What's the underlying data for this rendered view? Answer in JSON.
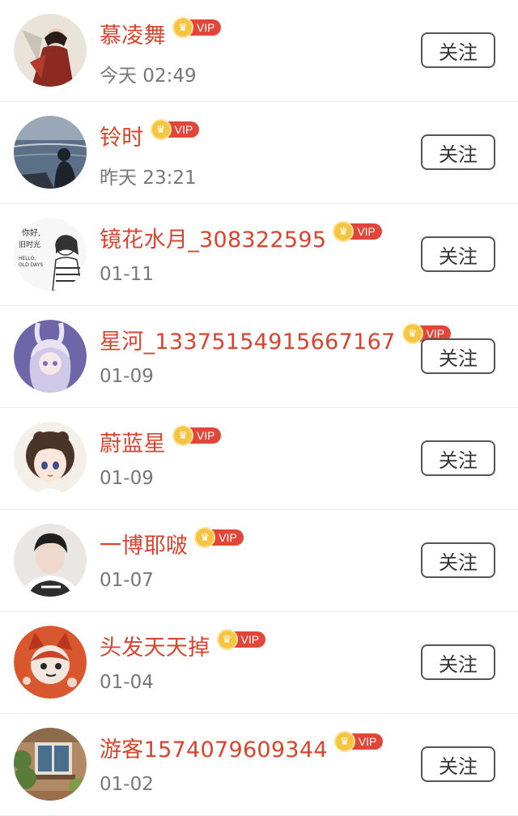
{
  "vip_label": "VIP",
  "follow_label": "关注",
  "users": [
    {
      "name": "慕凌舞",
      "time": "今天 02:49",
      "avatar": "avatar-woman-red-dress",
      "bg": "#e9e3da",
      "fg": "#8a2a22"
    },
    {
      "name": "铃时",
      "time": "昨天 23:21",
      "avatar": "avatar-person-by-sea",
      "bg": "#5b6f86",
      "fg": "#1d232b"
    },
    {
      "name": "镜花水月_308322595",
      "time": "01-11",
      "avatar": "avatar-sketch-girl",
      "bg": "#f7f7f7",
      "fg": "#333333"
    },
    {
      "name": "星河_13375154915667167",
      "time": "01-09",
      "avatar": "avatar-anime-bunny-girl",
      "bg": "#6d66a8",
      "fg": "#e8e2f4"
    },
    {
      "name": "蔚蓝星",
      "time": "01-09",
      "avatar": "avatar-anime-girl",
      "bg": "#f4efe9",
      "fg": "#4a3428"
    },
    {
      "name": "一博耶啵",
      "time": "01-07",
      "avatar": "avatar-young-man",
      "bg": "#e9e6e4",
      "fg": "#2e2e2e"
    },
    {
      "name": "头发天天掉",
      "time": "01-04",
      "avatar": "avatar-cartoon-cat",
      "bg": "#d9572e",
      "fg": "#f4d7c9"
    },
    {
      "name": "游客1574079609344",
      "time": "01-02",
      "avatar": "avatar-building-window",
      "bg": "#b08a64",
      "fg": "#5a7c3b"
    }
  ]
}
